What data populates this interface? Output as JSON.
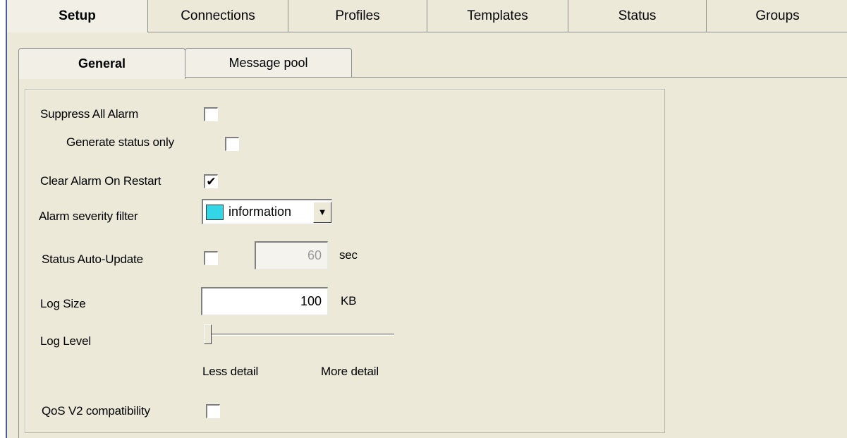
{
  "top_tabs": [
    {
      "label": "Setup",
      "active": true
    },
    {
      "label": "Connections"
    },
    {
      "label": "Profiles"
    },
    {
      "label": "Templates"
    },
    {
      "label": "Status"
    },
    {
      "label": "Groups"
    }
  ],
  "sub_tabs": [
    {
      "label": "General",
      "active": true
    },
    {
      "label": "Message pool"
    }
  ],
  "form": {
    "suppress_all_alarm": {
      "label": "Suppress All Alarm",
      "checked": false
    },
    "generate_status_only": {
      "label": "Generate status only",
      "checked": false
    },
    "clear_alarm_on_restart": {
      "label": "Clear Alarm On Restart",
      "checked": true,
      "check_mark": "✔"
    },
    "alarm_severity_filter": {
      "label": "Alarm severity filter",
      "value": "information",
      "swatch_color": "#33d6e6",
      "dropdown_glyph": "▼"
    },
    "status_auto_update": {
      "label": "Status Auto-Update",
      "checked": false,
      "value": "60",
      "unit": "sec"
    },
    "log_size": {
      "label": "Log Size",
      "value": "100",
      "unit": "KB"
    },
    "log_level": {
      "label": "Log Level",
      "min_label": "Less detail",
      "max_label": "More detail",
      "level": 0.0
    },
    "qos_v2": {
      "label": "QoS V2 compatibility",
      "checked": false
    }
  },
  "colors": {
    "window_bg": "#ece9d8",
    "accent_border": "#4a5c9c"
  }
}
